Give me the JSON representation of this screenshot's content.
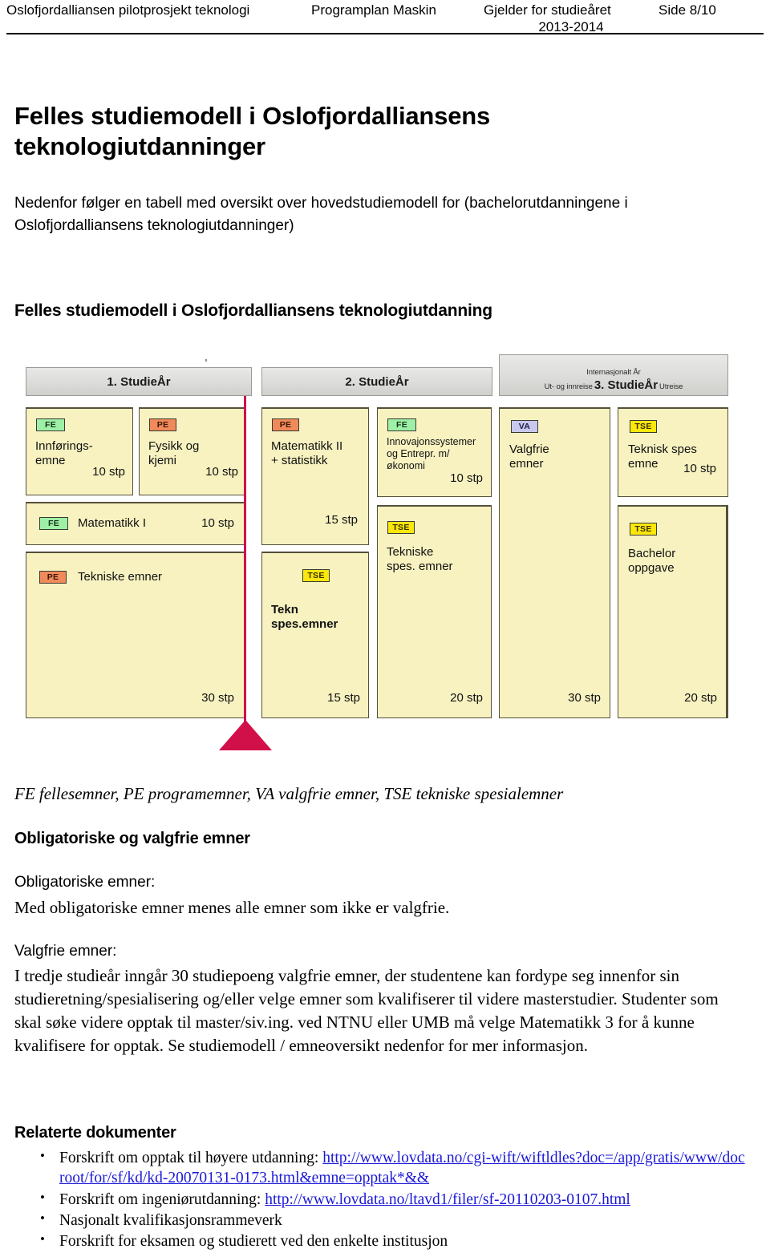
{
  "header": {
    "left": "Oslofjordalliansen pilotprosjekt teknologi",
    "center": "Programplan Maskin",
    "valid_label": "Gjelder for studieåret",
    "valid_years": "2013-2014",
    "page": "Side 8/10"
  },
  "main": {
    "title": "Felles studiemodell i Oslofjordalliansens teknologiutdanninger",
    "intro": "Nedenfor følger en tabell med oversikt over hovedstudiemodell for (bachelorutdanningene i Oslofjordalliansens teknologiutdanninger)",
    "diagram_heading": "Felles studiemodell i Oslofjordalliansens teknologiutdanning",
    "legend": "FE fellesemner, PE programemner, VA valgfrie emner, TSE tekniske spesialemner",
    "section_heading": "Obligatoriske og valgfrie emner",
    "obligatoriske_label": "Obligatoriske emner:",
    "obligatoriske_text": "Med obligatoriske emner menes alle emner som ikke er valgfrie.",
    "valgfrie_label": "Valgfrie emner:",
    "valgfrie_text": "I  tredje studieår inngår 30 studiepoeng  valgfrie emner, der studentene kan fordype seg innenfor sin studieretning/spesialisering og/eller velge emner som kvalifiserer til videre masterstudier.  Studenter som skal søke videre opptak til master/siv.ing. ved NTNU eller UMB må velge Matematikk 3 for å kunne kvalifisere for opptak. Se studiemodell / emneoversikt nedenfor for mer informasjon."
  },
  "diagram": {
    "years": [
      {
        "label": "1. StudieÅr"
      },
      {
        "label": "2. StudieÅr"
      },
      {
        "label": "3. StudieÅr",
        "international": "Internasjonalt År",
        "left_note": "Ut- og innreise",
        "right_note": "Utreise"
      }
    ],
    "courses": [
      {
        "tag": "FE",
        "title": "Innførings-\nemne",
        "stp": "10 stp"
      },
      {
        "tag": "PE",
        "title": "Fysikk og\nkjemi",
        "stp": "10 stp"
      },
      {
        "tag": "FE",
        "title": "Matematikk I",
        "stp": "10 stp"
      },
      {
        "tag": "PE",
        "title": "Tekniske emner",
        "stp": "30 stp"
      },
      {
        "tag": "PE",
        "title": "Matematikk II\n+ statistikk",
        "stp": "15 stp"
      },
      {
        "tag": "TSE",
        "title": "Tekn\nspes.emner",
        "stp": "15 stp"
      },
      {
        "tag": "FE",
        "title": "Innovajonssystemer\nog Entrepr. m/\nøkonomi",
        "stp": "10 stp"
      },
      {
        "tag": "TSE",
        "title": "Tekniske\nspes. emner",
        "stp": "20 stp"
      },
      {
        "tag": "VA",
        "title": "Valgfrie\nemner",
        "stp": "30 stp"
      },
      {
        "tag": "TSE",
        "title": "Teknisk spes\nemne",
        "stp": "10 stp"
      },
      {
        "tag": "TSE",
        "title": "Bachelor\noppgave",
        "stp": "20 stp"
      }
    ],
    "colors": {
      "FE": "#9ef0a6",
      "PE": "#f08a5a",
      "TSE": "#fbe70b",
      "VA": "#c8c8ee",
      "box_fill": "#f7f2c0",
      "arrow": "#d1104a"
    }
  },
  "related": {
    "heading": "Relaterte dokumenter",
    "items": [
      {
        "text": "Forskrift om opptak til høyere utdanning: ",
        "link": "http://www.lovdata.no/cgi-wift/wiftldles?doc=/app/gratis/www/docroot/for/sf/kd/kd-20070131-0173.html&emne=opptak*&&"
      },
      {
        "text": "Forskrift om ingeniørutdanning: ",
        "link": "http://www.lovdata.no/ltavd1/filer/sf-20110203-0107.html"
      },
      {
        "text": "Nasjonalt kvalifikasjonsrammeverk",
        "link": ""
      },
      {
        "text": "Forskrift for eksamen og studierett ved den enkelte institusjon",
        "link": ""
      }
    ]
  }
}
